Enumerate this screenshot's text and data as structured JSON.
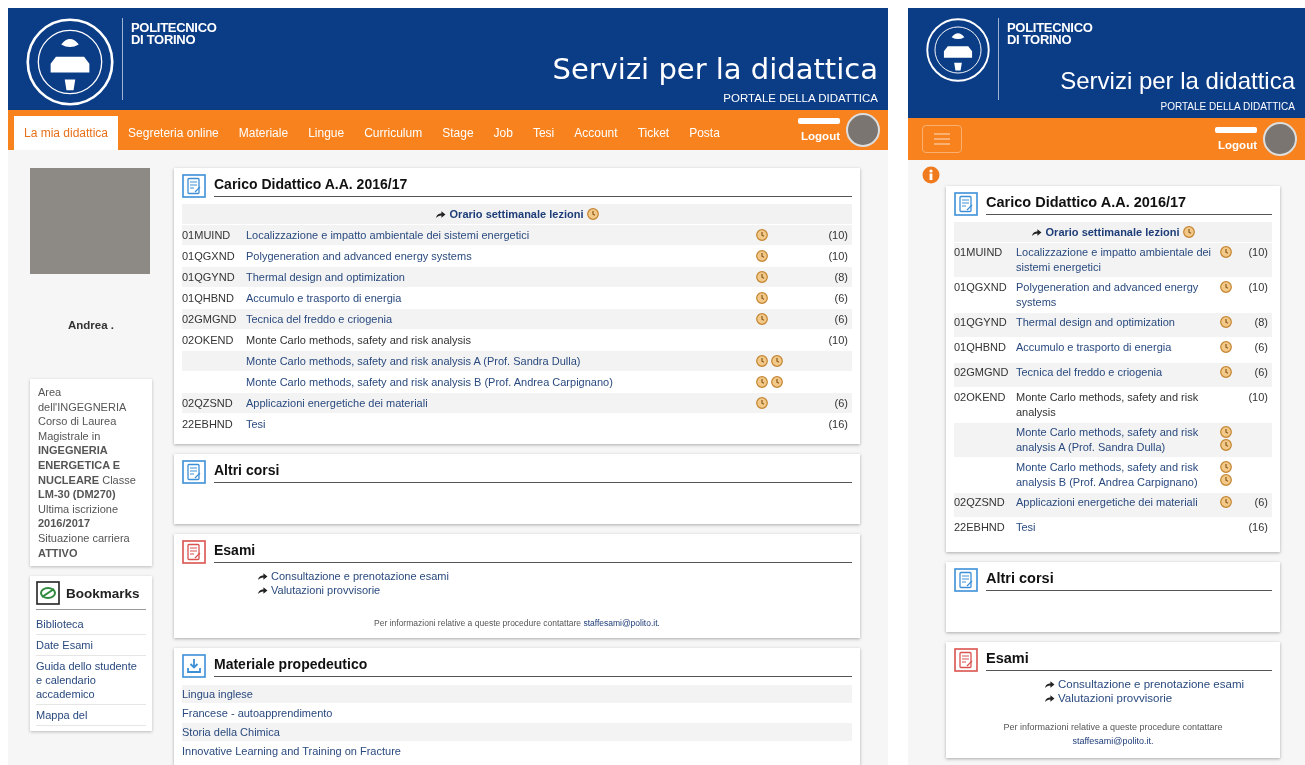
{
  "desktop": {
    "header": {
      "wordmark": [
        "POLITECNICO",
        "DI TORINO"
      ],
      "title": "Servizi per la didattica",
      "subtitle": "PORTALE DELLA DIDATTICA"
    },
    "nav": {
      "items": [
        {
          "label": "La mia didattica",
          "selected": true
        },
        {
          "label": "Segreteria online",
          "selected": false
        },
        {
          "label": "Materiale",
          "selected": false
        },
        {
          "label": "Lingue",
          "selected": false
        },
        {
          "label": "Curriculum",
          "selected": false
        },
        {
          "label": "Stage",
          "selected": false
        },
        {
          "label": "Job",
          "selected": false
        },
        {
          "label": "Tesi",
          "selected": false
        },
        {
          "label": "Account",
          "selected": false
        },
        {
          "label": "Ticket",
          "selected": false
        },
        {
          "label": "Posta",
          "selected": false
        }
      ],
      "logout": "Logout"
    },
    "profile": {
      "name": "Andrea .",
      "details": "Area dell'INGEGNERIA Corso di Laurea Magistrale in **INGEGNERIA ENERGETICA E NUCLEARE** Classe **LM-30 (DM270)** Ultima iscrizione **2016/2017** Situazione carriera **ATTIVO**"
    },
    "bookmarks": {
      "title": "Bookmarks",
      "items": [
        "Biblioteca",
        "Date Esami",
        "Guida dello studente e calendario accademico",
        "Mappa del"
      ]
    },
    "panels": [
      {
        "kind": "courses",
        "title": "Carico Didattico A.A. 2016/17",
        "schedule_link": "Orario settimanale lezioni",
        "rows": [
          {
            "kind": "course",
            "code": "01MUIND",
            "name": "Localizzazione e impatto ambientale dei sistemi energetici",
            "credits": "(10)"
          },
          {
            "kind": "course",
            "code": "01QGXND",
            "name": "Polygeneration and advanced energy systems",
            "credits": "(10)"
          },
          {
            "kind": "course",
            "code": "01QGYND",
            "name": "Thermal design and optimization",
            "credits": "(8)"
          },
          {
            "kind": "course",
            "code": "01QHBND",
            "name": "Accumulo e trasporto di energia",
            "credits": "(6)"
          },
          {
            "kind": "course",
            "code": "02GMGND",
            "name": "Tecnica del freddo e criogenia",
            "credits": "(6)"
          },
          {
            "kind": "group",
            "code": "02OKEND",
            "name": "Monte Carlo methods, safety and risk analysis",
            "credits": "(10)"
          },
          {
            "kind": "module",
            "name": "Monte Carlo methods, safety and risk analysis A (Prof. Sandra Dulla)"
          },
          {
            "kind": "module",
            "name": "Monte Carlo methods, safety and risk analysis B (Prof. Andrea Carpignano)"
          },
          {
            "kind": "course",
            "code": "02QZSND",
            "name": "Applicazioni energetiche dei materiali",
            "credits": "(6)"
          },
          {
            "kind": "thesis",
            "code": "22EBHND",
            "name": "Tesi",
            "credits": "(16)"
          }
        ]
      },
      {
        "kind": "empty",
        "title": "Altri corsi"
      },
      {
        "kind": "exams",
        "title": "Esami",
        "links": [
          "Consultazione e prenotazione esami",
          "Valutazioni provvisorie"
        ],
        "note": "Per informazioni relative a queste procedure contattare",
        "email": "staffesami@polito.it."
      },
      {
        "kind": "list",
        "title": "Materiale propedeutico",
        "items": [
          "Lingua inglese",
          "Francese - autoapprendimento",
          "Storia della Chimica",
          "Innovative Learning and Training on Fracture"
        ]
      }
    ]
  },
  "mobile": {
    "header": {
      "wordmark": [
        "POLITECNICO",
        "DI TORINO"
      ],
      "title": "Servizi per la didattica",
      "subtitle": "PORTALE DELLA DIDATTICA"
    },
    "nav": {
      "logout": "Logout"
    },
    "panels": [
      {
        "kind": "courses",
        "title": "Carico Didattico A.A. 2016/17",
        "schedule_link": "Orario settimanale lezioni",
        "rows": [
          {
            "kind": "course",
            "code": "01MUIND",
            "name": "Localizzazione e impatto ambientale dei sistemi energetici",
            "credits": "(10)"
          },
          {
            "kind": "course",
            "code": "01QGXND",
            "name": "Polygeneration and advanced energy systems",
            "credits": "(10)"
          },
          {
            "kind": "course",
            "code": "01QGYND",
            "name": "Thermal design and optimization",
            "credits": "(8)"
          },
          {
            "kind": "course",
            "code": "01QHBND",
            "name": "Accumulo e trasporto di energia",
            "credits": "(6)"
          },
          {
            "kind": "course",
            "code": "02GMGND",
            "name": "Tecnica del freddo e criogenia",
            "credits": "(6)"
          },
          {
            "kind": "group",
            "code": "02OKEND",
            "name": "Monte Carlo methods, safety and risk analysis",
            "credits": "(10)"
          },
          {
            "kind": "module",
            "name": "Monte Carlo methods, safety and risk analysis A (Prof. Sandra Dulla)"
          },
          {
            "kind": "module",
            "name": "Monte Carlo methods, safety and risk analysis B (Prof. Andrea Carpignano)"
          },
          {
            "kind": "course",
            "code": "02QZSND",
            "name": "Applicazioni energetiche dei materiali",
            "credits": "(6)"
          },
          {
            "kind": "thesis",
            "code": "22EBHND",
            "name": "Tesi",
            "credits": "(16)"
          }
        ]
      },
      {
        "kind": "empty",
        "title": "Altri corsi"
      },
      {
        "kind": "exams",
        "title": "Esami",
        "links": [
          "Consultazione e prenotazione esami",
          "Valutazioni provvisorie"
        ],
        "note": "Per informazioni relative a queste procedure contattare",
        "email": "staffesami@polito.it."
      }
    ]
  }
}
